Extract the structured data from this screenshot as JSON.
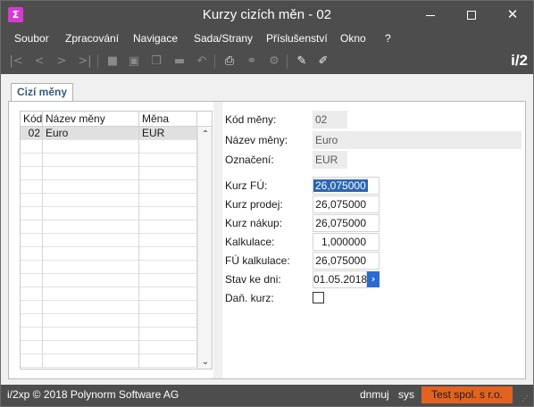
{
  "window": {
    "title": "Kurzy cizích měn - 02",
    "app_icon_glyph": "Σ",
    "close_glyph": "✕"
  },
  "menu": {
    "items": [
      "Soubor",
      "Zpracování",
      "Navigace",
      "Sada/Strany",
      "Příslušenství",
      "Okno",
      "?"
    ]
  },
  "toolbar": {
    "brand": "i/2",
    "icons": [
      "first-record-icon",
      "previous-record-icon",
      "next-record-icon",
      "last-record-icon",
      "save-icon",
      "new-record-icon",
      "copy-icon",
      "delete-icon",
      "undo-icon",
      "print-icon",
      "link-icon",
      "settings-icon",
      "edit-icon",
      "pen-icon"
    ]
  },
  "tab": {
    "label": "Cizí měny"
  },
  "grid": {
    "columns": [
      "Kód",
      "Název měny",
      "Měna"
    ],
    "rows": [
      {
        "code": "02",
        "name": "Euro",
        "currency": "EUR"
      }
    ]
  },
  "form": {
    "kod_label": "Kód měny:",
    "kod_value": "02",
    "nazev_label": "Název měny:",
    "nazev_value": "Euro",
    "oznaceni_label": "Označení:",
    "oznaceni_value": "EUR",
    "kurz_fu_label": "Kurz FÚ:",
    "kurz_fu_value": "26,075000",
    "kurz_prodej_label": "Kurz prodej:",
    "kurz_prodej_value": "26,075000",
    "kurz_nakup_label": "Kurz nákup:",
    "kurz_nakup_value": "26,075000",
    "kalkulace_label": "Kalkulace:",
    "kalkulace_value": "1,000000",
    "fu_kalkulace_label": "FÚ kalkulace:",
    "fu_kalkulace_value": "26,075000",
    "stav_label": "Stav ke dni:",
    "stav_value": "01.05.2018",
    "dan_kurz_label": "Daň. kurz:",
    "dan_kurz_checked": false
  },
  "status": {
    "copyright": "i/2xp © 2018 Polynorm Software AG",
    "user": "dnmuj",
    "db": "sys",
    "company": "Test spol. s r.o."
  },
  "colors": {
    "chrome": "#4d4d4d",
    "selection": "#2b66b3",
    "date_button": "#2a6bd1",
    "company_badge": "#e2631f"
  }
}
